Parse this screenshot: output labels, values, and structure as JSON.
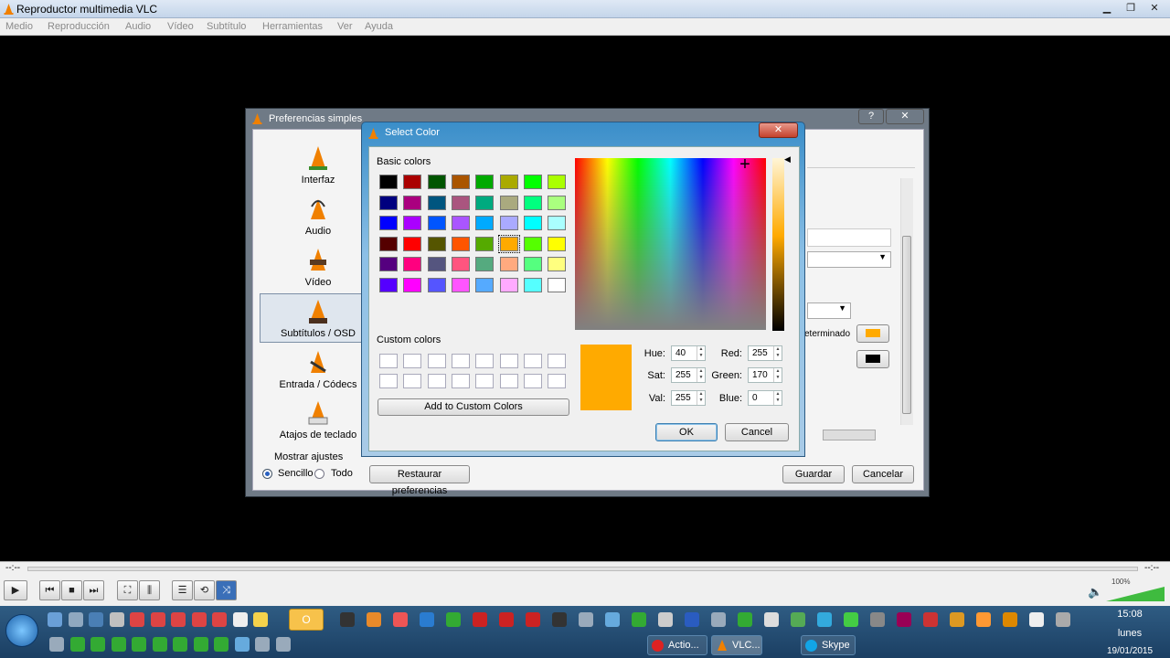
{
  "app": {
    "title": "Reproductor multimedia VLC",
    "menu": [
      "Medio",
      "Reproducción",
      "Audio",
      "Vídeo",
      "Subtítulo",
      "Herramientas",
      "Ver",
      "Ayuda"
    ]
  },
  "prefs": {
    "title": "Preferencias simples",
    "help_btn": "?",
    "close_btn": "✕",
    "sidebar": [
      "Interfaz",
      "Audio",
      "Vídeo",
      "Subtítulos / OSD",
      "Entrada / Códecs",
      "Atajos de teclado"
    ],
    "show_settings_label": "Mostrar ajustes",
    "mode_simple": "Sencillo",
    "mode_all": "Todo",
    "reset_button": "Restaurar preferencias",
    "save_button": "Guardar",
    "cancel_button": "Cancelar",
    "partial_label": "eterminado",
    "outline_color": "#ffaa00",
    "shadow_color": "#000000"
  },
  "color_dialog": {
    "title": "Select Color",
    "close": "✕",
    "basic_label": "Basic colors",
    "custom_label": "Custom colors",
    "add_custom": "Add to Custom Colors",
    "ok": "OK",
    "cancel": "Cancel",
    "hue_label": "Hue:",
    "hue": "40",
    "sat_label": "Sat:",
    "sat": "255",
    "val_label": "Val:",
    "val": "255",
    "red_label": "Red:",
    "red": "255",
    "green_label": "Green:",
    "green": "170",
    "blue_label": "Blue:",
    "blue": "0",
    "selected_color": "#ffaa00",
    "basic_colors": [
      [
        "#000000",
        "#aa0000",
        "#005500",
        "#aa5500",
        "#00aa00",
        "#aaaa00",
        "#00ff00",
        "#aaff00"
      ],
      [
        "#00007f",
        "#aa007f",
        "#00557f",
        "#aa557f",
        "#00aa7f",
        "#aaaa7f",
        "#00ff7f",
        "#aaff7f"
      ],
      [
        "#0000ff",
        "#aa00ff",
        "#0055ff",
        "#aa55ff",
        "#00aaff",
        "#aaaaff",
        "#00ffff",
        "#aaffff"
      ],
      [
        "#550000",
        "#ff0000",
        "#555500",
        "#ff5500",
        "#55aa00",
        "#ffaa00",
        "#55ff00",
        "#ffff00"
      ],
      [
        "#55007f",
        "#ff007f",
        "#55557f",
        "#ff557f",
        "#55aa7f",
        "#ffaa7f",
        "#55ff7f",
        "#ffff7f"
      ],
      [
        "#5500ff",
        "#ff00ff",
        "#5555ff",
        "#ff55ff",
        "#55aaff",
        "#ffaaff",
        "#55ffff",
        "#ffffff"
      ]
    ]
  },
  "player": {
    "time_left": "--:--",
    "time_right": "--:--",
    "volume": "100%"
  },
  "taskbar": {
    "tasks": [
      "Actio...",
      "VLC...",
      "Skype"
    ],
    "clock_time": "15:08",
    "clock_day": "lunes",
    "clock_date": "19/01/2015"
  }
}
